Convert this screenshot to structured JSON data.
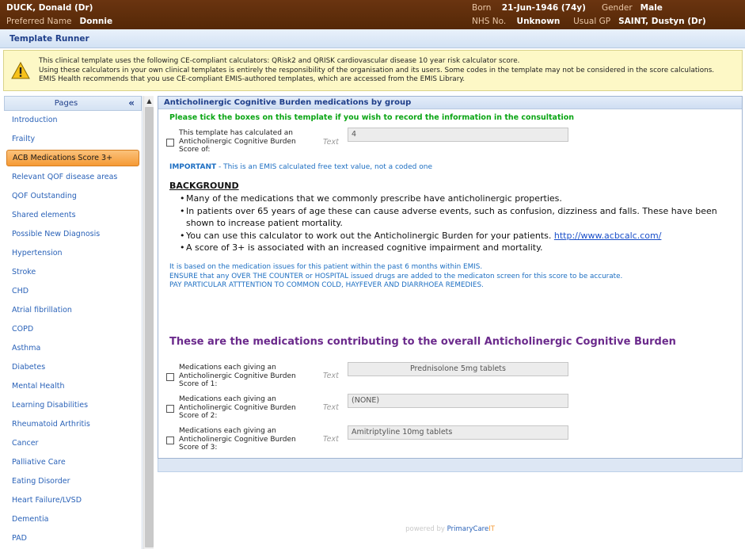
{
  "patient": {
    "name": "DUCK, Donald (Dr)",
    "preferred_label": "Preferred Name",
    "preferred_value": "Donnie",
    "born_label": "Born",
    "born_value": "21-Jun-1946 (74y)",
    "gender_label": "Gender",
    "gender_value": "Male",
    "nhs_label": "NHS No.",
    "nhs_value": "Unknown",
    "gp_label": "Usual GP",
    "gp_value": "SAINT, Dustyn (Dr)"
  },
  "app": {
    "title": "Template Runner"
  },
  "warning": {
    "lines": [
      "This clinical template uses the following CE-compliant calculators: QRisk2 and QRISK cardiovascular disease 10 year risk calculator score.",
      "Using these calculators in your own clinical templates is entirely the responsibility of the organisation and its users.  Some codes in the template may not be considered in the score calculations.",
      "EMIS Health recommends that you use CE-compliant EMIS-authored templates, which are accessed from the EMIS Library."
    ]
  },
  "sidebar": {
    "title": "Pages",
    "collapse": "«",
    "items": [
      {
        "label": "Introduction"
      },
      {
        "label": "Frailty"
      },
      {
        "label": "ACB Medications Score 3+"
      },
      {
        "label": "Relevant QOF disease areas"
      },
      {
        "label": "QOF Outstanding"
      },
      {
        "label": "Shared elements"
      },
      {
        "label": "Possible New Diagnosis"
      },
      {
        "label": "Hypertension"
      },
      {
        "label": "Stroke"
      },
      {
        "label": "CHD"
      },
      {
        "label": "Atrial fibrillation"
      },
      {
        "label": "COPD"
      },
      {
        "label": "Asthma"
      },
      {
        "label": "Diabetes"
      },
      {
        "label": "Mental Health"
      },
      {
        "label": "Learning Disabilities"
      },
      {
        "label": "Rheumatoid Arthritis"
      },
      {
        "label": "Cancer"
      },
      {
        "label": "Palliative Care"
      },
      {
        "label": "Eating Disorder"
      },
      {
        "label": "Heart Failure/LVSD"
      },
      {
        "label": "Dementia"
      },
      {
        "label": "PAD"
      }
    ]
  },
  "main": {
    "section_title": "Anticholinergic Cognitive Burden medications by group",
    "instruction": "Please tick the boxes on this template if you wish to record the information in the consultation",
    "score_field": {
      "label": "This template has calculated an Anticholinergic Cognitive Burden Score of:",
      "type": "Text",
      "value": "4"
    },
    "important_bold": "IMPORTANT",
    "important_text": " - This is an EMIS calculated free text value, not a coded one",
    "background_heading": "BACKGROUND",
    "bullets": [
      "Many of the medications that we commonly prescribe have anticholinergic properties.",
      "In patients over 65 years of age these can cause adverse events, such as confusion, dizziness and falls. These have been shown to increase patient mortality.",
      "You can use this calculator to work out the Anticholinergic Burden for your patients.",
      "A score of 3+ is associated with an increased cognitive impairment and mortality."
    ],
    "link": "http://www.acbcalc.com/",
    "notes": [
      "It is based on the medication issues for this patient within the past 6 months within EMIS.",
      "ENSURE that any OVER THE COUNTER or HOSPITAL issued drugs are added to the medicaton screen for this score to be accurate.",
      "PAY PARTICULAR ATTTENTION TO COMMON COLD, HAYFEVER AND DIARRHOEA REMEDIES."
    ],
    "medications_heading": "These are the medications contributing to the overall Anticholinergic Cognitive Burden",
    "med_fields": [
      {
        "label": "Medications each giving an Anticholinergic Cognitive Burden Score of 1:",
        "type": "Text",
        "value": "Prednisolone 5mg tablets"
      },
      {
        "label": "Medications each giving an Anticholinergic Cognitive Burden Score of 2:",
        "type": "Text",
        "value": "(NONE)"
      },
      {
        "label": "Medications each giving an Anticholinergic Cognitive Burden Score of 3:",
        "type": "Text",
        "value": "Amitriptyline 10mg tablets"
      }
    ],
    "powered_prefix": "powered by ",
    "powered_brand1": "PrimaryCare",
    "powered_brand2": "IT"
  },
  "colors": {
    "banner": "#5e2d0a",
    "accent_blue": "#1f3f8a",
    "active_item": "#f59a35",
    "instruction_green": "#0aa514",
    "heading_purple": "#6b2a8c"
  }
}
